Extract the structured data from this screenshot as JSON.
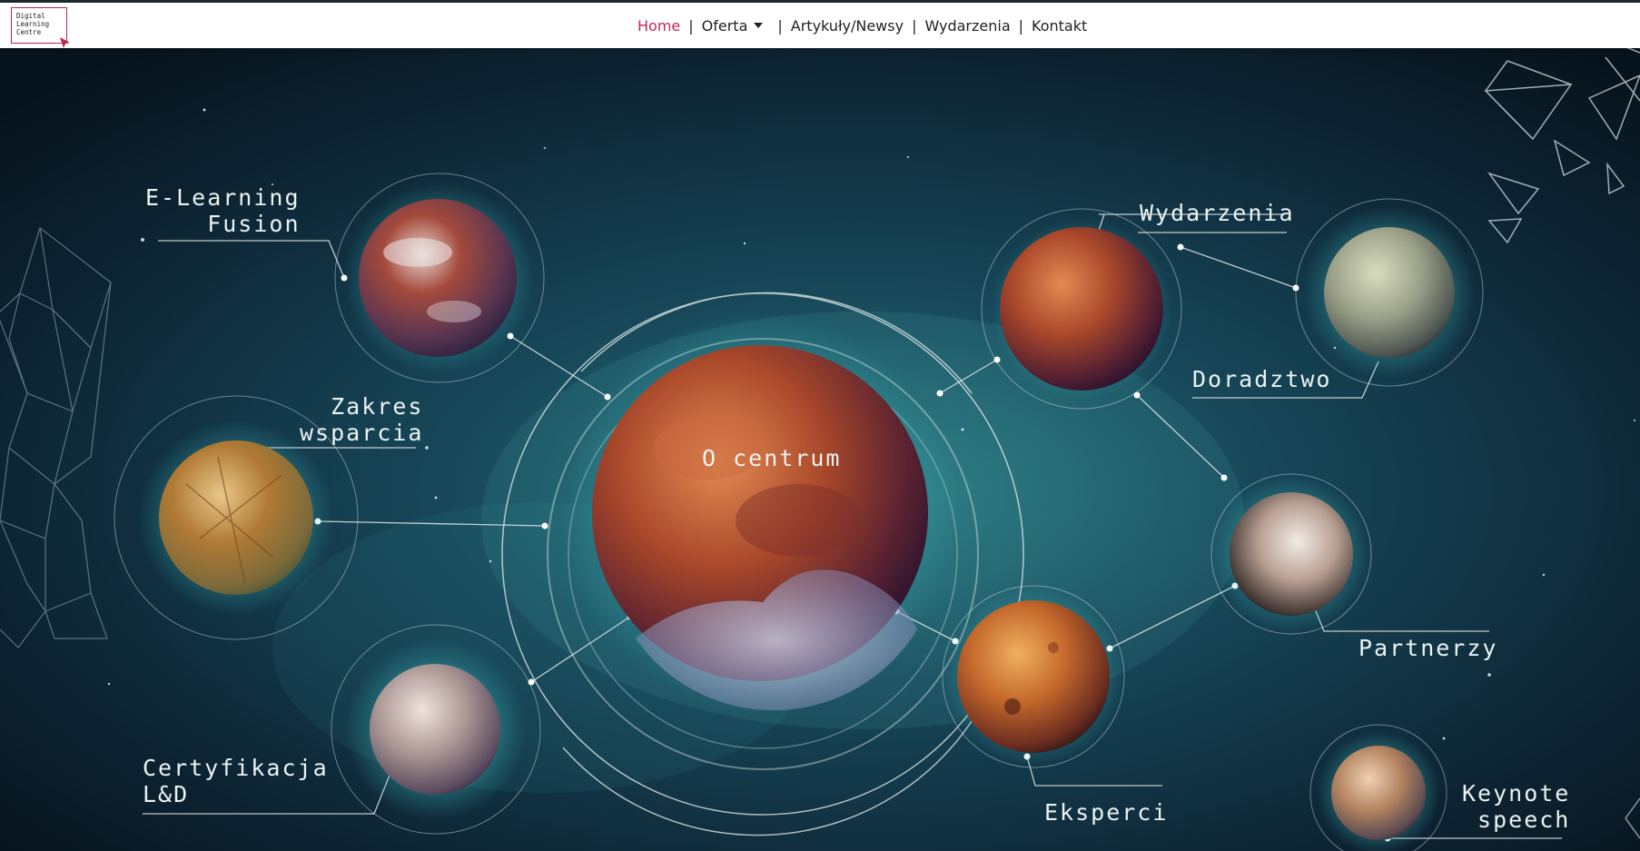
{
  "logo": {
    "line1": "Digital",
    "line2": "Learning",
    "line3": "Centre"
  },
  "nav": {
    "home": "Home",
    "oferta": "Oferta",
    "artykuly": "Artykuły/Newsy",
    "wydarzenia": "Wydarzenia",
    "kontakt": "Kontakt",
    "separator": "|"
  },
  "labels": {
    "elearning_1": "E-Learning",
    "elearning_2": "Fusion",
    "zakres_1": "Zakres",
    "zakres_2": "wsparcia",
    "certyfikacja_1": "Certyfikacja",
    "certyfikacja_2": "L&D",
    "centrum": "O centrum",
    "wydarzenia": "Wydarzenia",
    "doradztwo": "Doradztwo",
    "partnerzy": "Partnerzy",
    "eksperci": "Eksperci",
    "keynote_1": "Keynote",
    "keynote_2": "speech"
  },
  "colors": {
    "accent": "#c8264f",
    "label": "#eaf2f2",
    "glow": "#3fc7c9",
    "space": "#0a1a26"
  }
}
